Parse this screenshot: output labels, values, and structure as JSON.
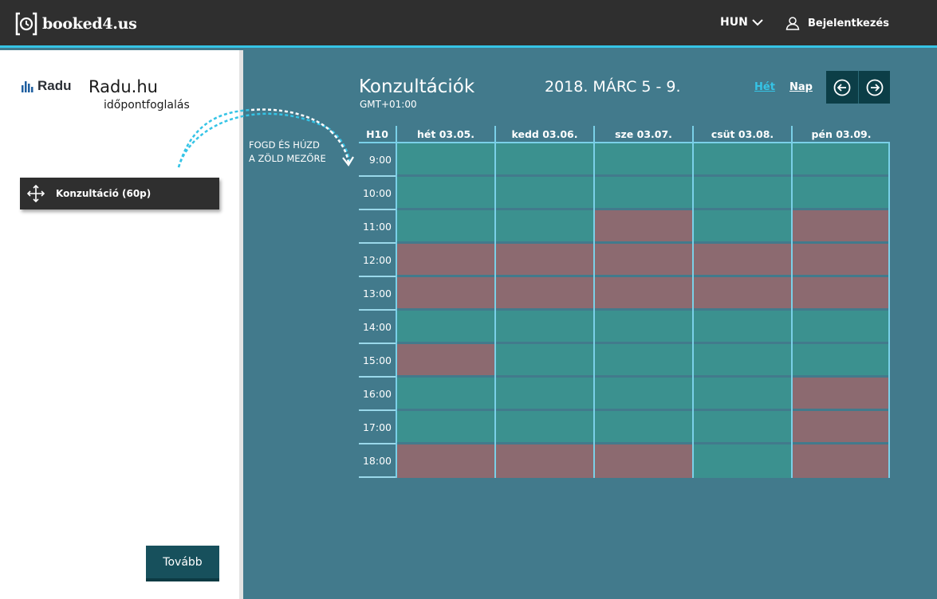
{
  "brand": {
    "name": "booked4.us"
  },
  "topbar": {
    "language": "HUN",
    "login_label": "Bejelentkezés"
  },
  "company": {
    "logo_text": "Radu",
    "name": "Radu.hu",
    "subtitle": "időpontfoglalás"
  },
  "service": {
    "label": "Konzultáció (60p)"
  },
  "hint": {
    "line1": "FOGD ÉS HÚZD",
    "line2": "A ZÖLD MEZŐRE"
  },
  "next_button": {
    "label": "Tovább"
  },
  "calendar": {
    "title": "Konzultációk",
    "timezone": "GMT+01:00",
    "range": "2018. MÁRC 5 - 9.",
    "view_week": "Hét",
    "view_day": "Nap",
    "week_label": "H10",
    "days": [
      "hét 03.05.",
      "kedd 03.06.",
      "sze 03.07.",
      "csüt 03.08.",
      "pén 03.09."
    ],
    "rows": [
      {
        "time": "9:00",
        "slots": [
          "free",
          "free",
          "free",
          "free",
          "free"
        ]
      },
      {
        "time": "10:00",
        "slots": [
          "free",
          "free",
          "free",
          "free",
          "free"
        ]
      },
      {
        "time": "11:00",
        "slots": [
          "free",
          "free",
          "busy",
          "free",
          "busy"
        ]
      },
      {
        "time": "12:00",
        "slots": [
          "busy",
          "busy",
          "busy",
          "busy",
          "busy"
        ]
      },
      {
        "time": "13:00",
        "slots": [
          "busy",
          "busy",
          "busy",
          "busy",
          "busy"
        ]
      },
      {
        "time": "14:00",
        "slots": [
          "free",
          "free",
          "free",
          "free",
          "free"
        ]
      },
      {
        "time": "15:00",
        "slots": [
          "busy",
          "free",
          "free",
          "free",
          "free"
        ]
      },
      {
        "time": "16:00",
        "slots": [
          "free",
          "free",
          "free",
          "free",
          "busy"
        ]
      },
      {
        "time": "17:00",
        "slots": [
          "free",
          "free",
          "free",
          "free",
          "busy"
        ]
      },
      {
        "time": "18:00",
        "slots": [
          "busy",
          "busy",
          "busy",
          "free",
          "busy"
        ]
      }
    ]
  },
  "colors": {
    "accent": "#35c4e6",
    "free_slot": "#3b918f",
    "busy_slot": "#8c6a70",
    "background": "#427a8c",
    "topbar": "#2f2f2f",
    "button": "#17505c"
  }
}
